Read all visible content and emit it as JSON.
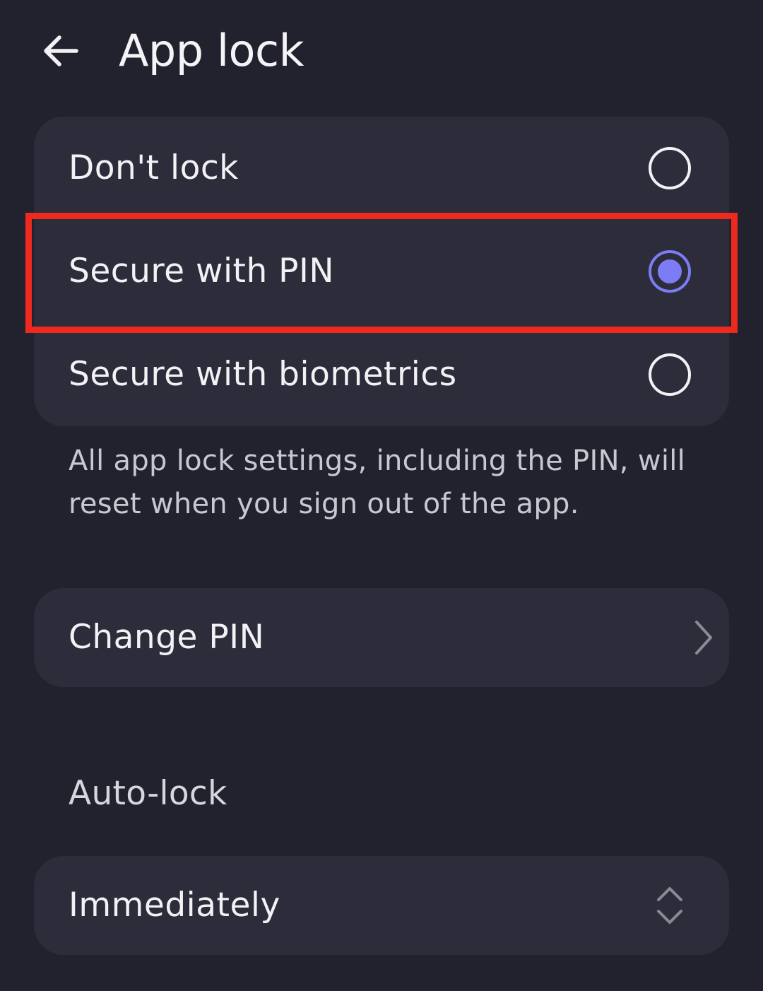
{
  "header": {
    "title": "App lock",
    "back_icon": "arrow-left-icon"
  },
  "lock_options": {
    "items": [
      {
        "label": "Don't lock",
        "selected": false
      },
      {
        "label": "Secure with PIN",
        "selected": true
      },
      {
        "label": "Secure with biometrics",
        "selected": false
      }
    ]
  },
  "note": "All app lock settings, including the PIN, will reset when you sign out of the app.",
  "change_pin": {
    "label": "Change PIN",
    "icon": "chevron-right-icon"
  },
  "auto_lock": {
    "heading": "Auto-lock",
    "selected_value": "Immediately",
    "icon": "chevron-up-down-icon"
  },
  "colors": {
    "background": "#22222f",
    "card": "#2c2c3a",
    "accent": "#7c7cf5",
    "highlight": "#ee2a1e"
  }
}
